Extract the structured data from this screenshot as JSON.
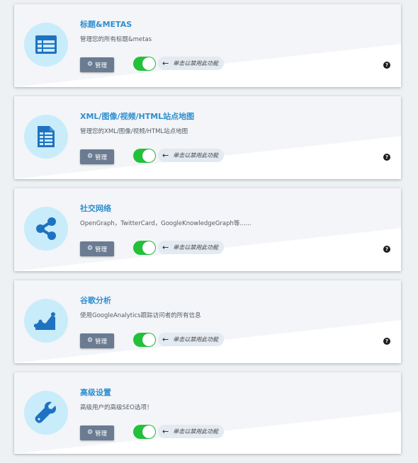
{
  "colors": {
    "accent": "#2f8fd0",
    "toggle_on": "#22c13a",
    "button": "#6a7b92",
    "icon_bg": "#c8ecfa",
    "icon": "#1f72c1"
  },
  "cards": [
    {
      "title": "标题&METAS",
      "desc": "管理您的所有标题&metas",
      "icon": "table-icon",
      "button": "管理",
      "hint": "单击以禁用此功能",
      "help": "?",
      "enabled": true
    },
    {
      "title": "XML/图像/视频/HTML站点地图",
      "desc": "管理您的XML/图像/视频/HTML站点地图",
      "icon": "document-icon",
      "button": "管理",
      "hint": "单击以禁用此功能",
      "help": "?",
      "enabled": true
    },
    {
      "title": "社交网络",
      "desc": "OpenGraph，TwitterCard，GoogleKnowledgeGraph等......",
      "icon": "share-icon",
      "button": "管理",
      "hint": "单击以禁用此功能",
      "help": "?",
      "enabled": true
    },
    {
      "title": "谷歌分析",
      "desc": "使用GoogleAnalytics跟踪访问者的所有信息",
      "icon": "chart-icon",
      "button": "管理",
      "hint": "单击以禁用此功能",
      "help": "?",
      "enabled": true
    },
    {
      "title": "高级设置",
      "desc": "高级用户的高级SEO选项！",
      "icon": "wrench-icon",
      "button": "管理",
      "hint": "单击以禁用此功能",
      "help": null,
      "enabled": true
    }
  ]
}
